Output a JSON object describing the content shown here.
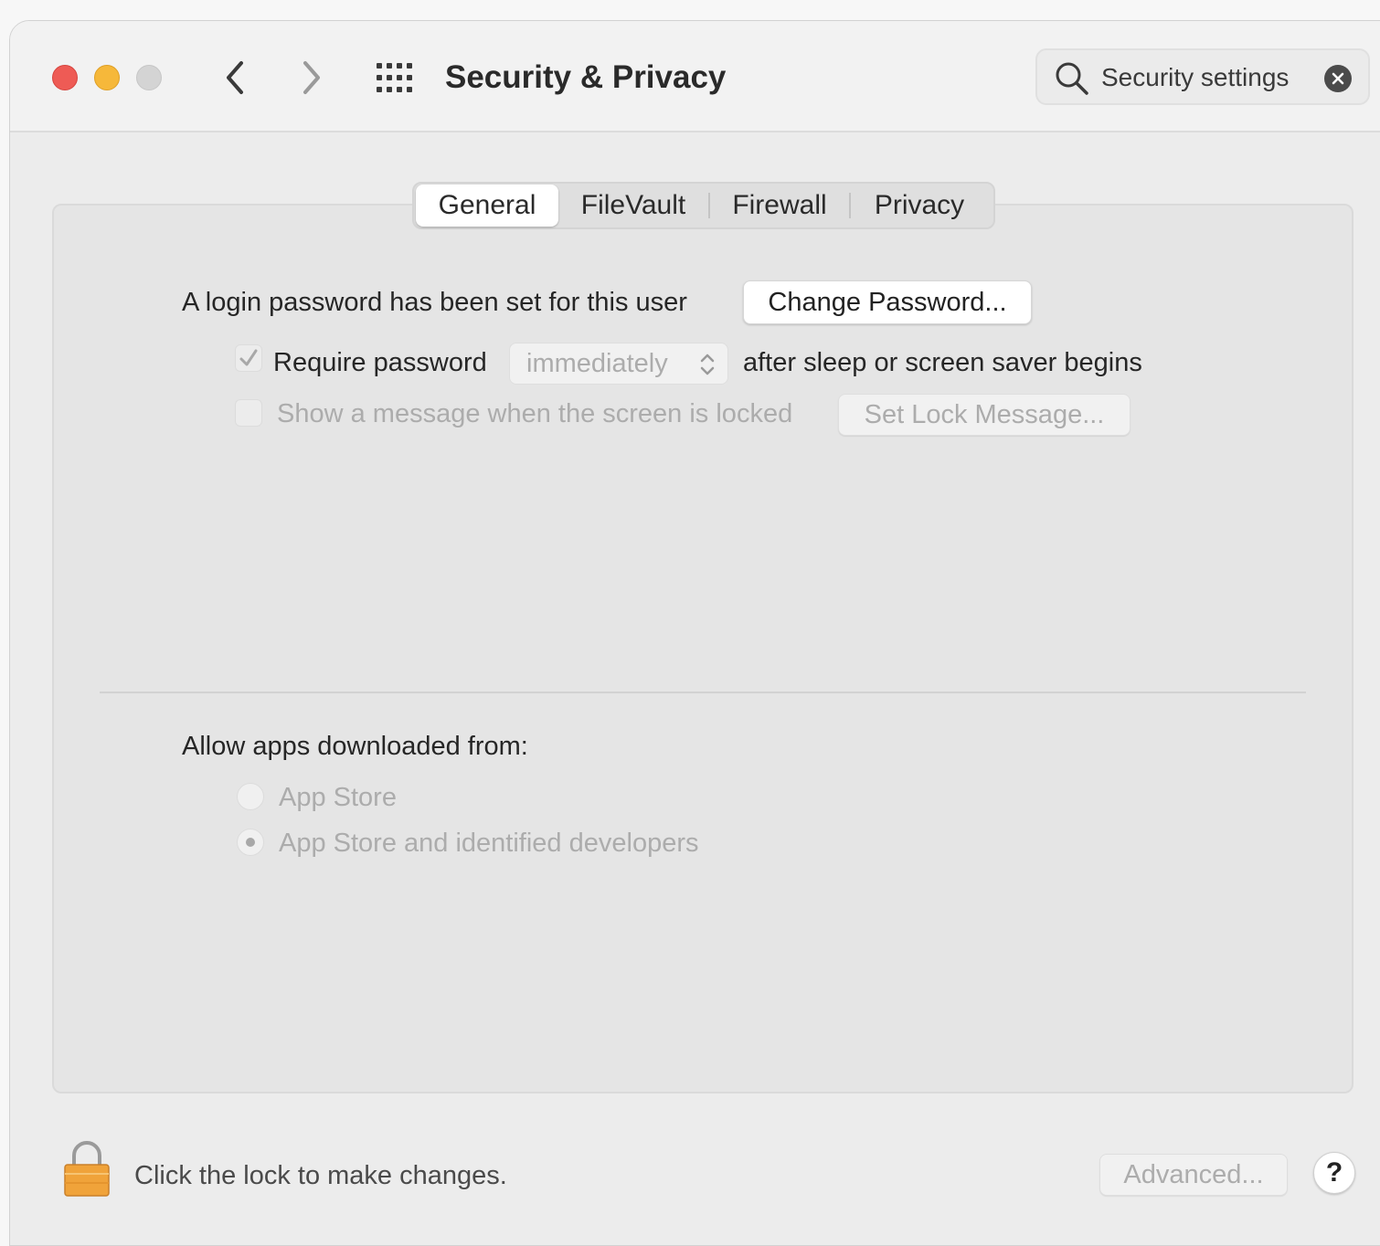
{
  "window": {
    "title": "Security & Privacy"
  },
  "search": {
    "value": "Security settings"
  },
  "tabs": [
    {
      "label": "General",
      "active": true
    },
    {
      "label": "FileVault",
      "active": false
    },
    {
      "label": "Firewall",
      "active": false
    },
    {
      "label": "Privacy",
      "active": false
    }
  ],
  "general": {
    "login_text": "A login password has been set for this user",
    "change_password_label": "Change Password...",
    "require_password_label": "Require password",
    "require_password_checked": true,
    "require_delay_value": "immediately",
    "after_sleep_text": "after sleep or screen saver begins",
    "show_message_label": "Show a message when the screen is locked",
    "show_message_checked": false,
    "set_lock_message_label": "Set Lock Message..."
  },
  "allow_apps": {
    "heading": "Allow apps downloaded from:",
    "options": [
      {
        "label": "App Store",
        "selected": false
      },
      {
        "label": "App Store and identified developers",
        "selected": true
      }
    ]
  },
  "footer": {
    "lock_text": "Click the lock to make changes.",
    "advanced_label": "Advanced...",
    "help_label": "?"
  },
  "colors": {
    "close": "#ee5b55",
    "minimize": "#f6b83a",
    "zoom_disabled": "#d4d4d4",
    "lock_body": "#f0a33a"
  }
}
